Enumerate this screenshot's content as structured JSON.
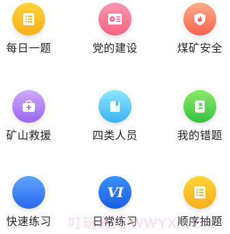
{
  "tiles": [
    {
      "label": "每日一题",
      "icon": "daily-question-icon",
      "color": "#ffc12b"
    },
    {
      "label": "党的建设",
      "icon": "party-building-icon",
      "color": "#f97d98"
    },
    {
      "label": "煤矿安全",
      "icon": "coal-mine-safety-icon",
      "color": "#f8845f"
    },
    {
      "label": "矿山救援",
      "icon": "mine-rescue-icon",
      "color": "#b589f8"
    },
    {
      "label": "四类人员",
      "icon": "four-categories-personnel-icon",
      "color": "#5fcaf8"
    },
    {
      "label": "我的错题",
      "icon": "my-wrong-questions-icon",
      "color": "#5bd550"
    },
    {
      "label": "快速练习",
      "icon": "quick-practice-icon",
      "color": "#3a7ff5"
    },
    {
      "label": "日常练习",
      "icon": "daily-practice-icon",
      "color": "#2271ea",
      "icon_text": "VI"
    },
    {
      "label": "顺序抽题",
      "icon": "sequential-questions-icon",
      "color": "#ffc12b"
    }
  ],
  "watermark": "叮玩意儿 WWYX.COM"
}
